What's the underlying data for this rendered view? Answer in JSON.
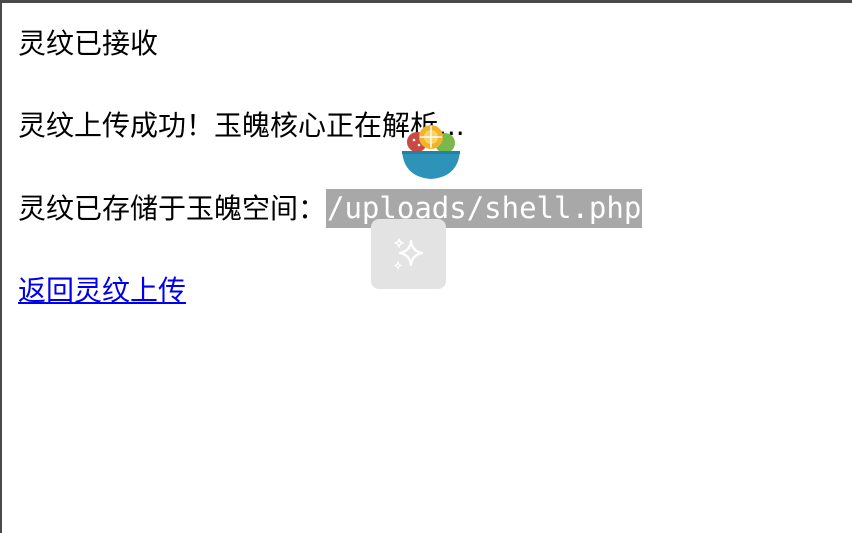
{
  "page": {
    "title_text": "灵纹已接收",
    "upload_success_message": "灵纹上传成功！玉魄核心正在解析...",
    "stored_label": "灵纹已存储于玉魄空间：",
    "stored_path": "/uploads/shell.php",
    "back_link_label": "返回灵纹上传"
  },
  "overlay": {
    "logo_icon": "fruit-bowl-icon",
    "assist_icon": "sparkle-icon"
  },
  "colors": {
    "link": "#0000ee",
    "path_highlight": "#a8a8a8",
    "bowl_blue": "#2e93b8",
    "assist_card": "#e3e3e3"
  }
}
